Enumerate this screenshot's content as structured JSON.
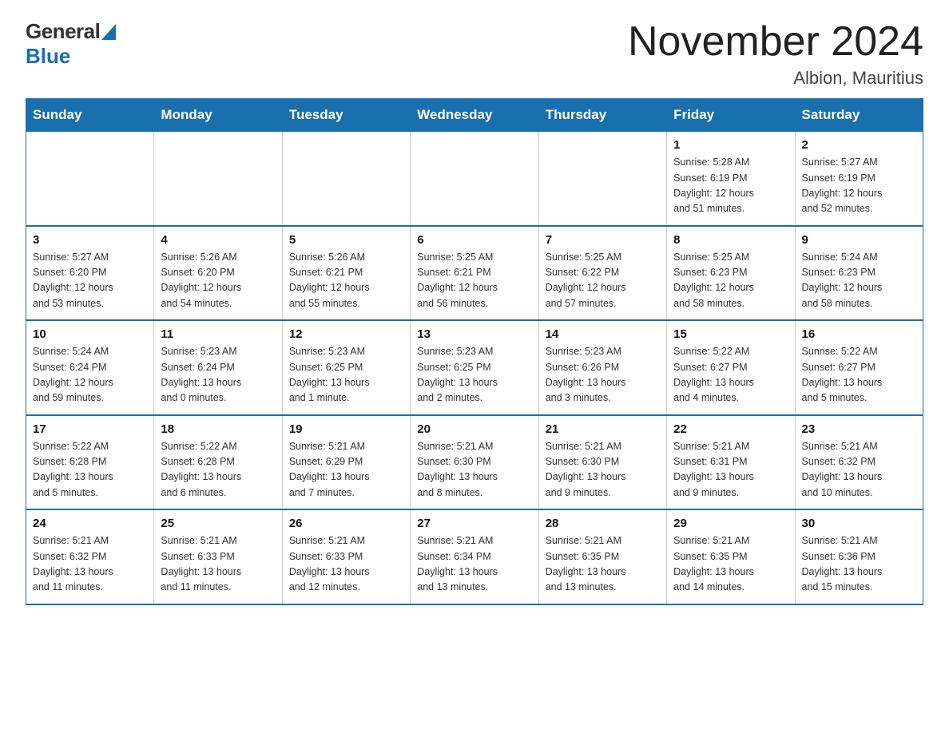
{
  "header": {
    "logo_general": "General",
    "logo_blue": "Blue",
    "title": "November 2024",
    "subtitle": "Albion, Mauritius"
  },
  "weekdays": [
    "Sunday",
    "Monday",
    "Tuesday",
    "Wednesday",
    "Thursday",
    "Friday",
    "Saturday"
  ],
  "weeks": [
    [
      {
        "day": "",
        "info": ""
      },
      {
        "day": "",
        "info": ""
      },
      {
        "day": "",
        "info": ""
      },
      {
        "day": "",
        "info": ""
      },
      {
        "day": "",
        "info": ""
      },
      {
        "day": "1",
        "info": "Sunrise: 5:28 AM\nSunset: 6:19 PM\nDaylight: 12 hours\nand 51 minutes."
      },
      {
        "day": "2",
        "info": "Sunrise: 5:27 AM\nSunset: 6:19 PM\nDaylight: 12 hours\nand 52 minutes."
      }
    ],
    [
      {
        "day": "3",
        "info": "Sunrise: 5:27 AM\nSunset: 6:20 PM\nDaylight: 12 hours\nand 53 minutes."
      },
      {
        "day": "4",
        "info": "Sunrise: 5:26 AM\nSunset: 6:20 PM\nDaylight: 12 hours\nand 54 minutes."
      },
      {
        "day": "5",
        "info": "Sunrise: 5:26 AM\nSunset: 6:21 PM\nDaylight: 12 hours\nand 55 minutes."
      },
      {
        "day": "6",
        "info": "Sunrise: 5:25 AM\nSunset: 6:21 PM\nDaylight: 12 hours\nand 56 minutes."
      },
      {
        "day": "7",
        "info": "Sunrise: 5:25 AM\nSunset: 6:22 PM\nDaylight: 12 hours\nand 57 minutes."
      },
      {
        "day": "8",
        "info": "Sunrise: 5:25 AM\nSunset: 6:23 PM\nDaylight: 12 hours\nand 58 minutes."
      },
      {
        "day": "9",
        "info": "Sunrise: 5:24 AM\nSunset: 6:23 PM\nDaylight: 12 hours\nand 58 minutes."
      }
    ],
    [
      {
        "day": "10",
        "info": "Sunrise: 5:24 AM\nSunset: 6:24 PM\nDaylight: 12 hours\nand 59 minutes."
      },
      {
        "day": "11",
        "info": "Sunrise: 5:23 AM\nSunset: 6:24 PM\nDaylight: 13 hours\nand 0 minutes."
      },
      {
        "day": "12",
        "info": "Sunrise: 5:23 AM\nSunset: 6:25 PM\nDaylight: 13 hours\nand 1 minute."
      },
      {
        "day": "13",
        "info": "Sunrise: 5:23 AM\nSunset: 6:25 PM\nDaylight: 13 hours\nand 2 minutes."
      },
      {
        "day": "14",
        "info": "Sunrise: 5:23 AM\nSunset: 6:26 PM\nDaylight: 13 hours\nand 3 minutes."
      },
      {
        "day": "15",
        "info": "Sunrise: 5:22 AM\nSunset: 6:27 PM\nDaylight: 13 hours\nand 4 minutes."
      },
      {
        "day": "16",
        "info": "Sunrise: 5:22 AM\nSunset: 6:27 PM\nDaylight: 13 hours\nand 5 minutes."
      }
    ],
    [
      {
        "day": "17",
        "info": "Sunrise: 5:22 AM\nSunset: 6:28 PM\nDaylight: 13 hours\nand 5 minutes."
      },
      {
        "day": "18",
        "info": "Sunrise: 5:22 AM\nSunset: 6:28 PM\nDaylight: 13 hours\nand 6 minutes."
      },
      {
        "day": "19",
        "info": "Sunrise: 5:21 AM\nSunset: 6:29 PM\nDaylight: 13 hours\nand 7 minutes."
      },
      {
        "day": "20",
        "info": "Sunrise: 5:21 AM\nSunset: 6:30 PM\nDaylight: 13 hours\nand 8 minutes."
      },
      {
        "day": "21",
        "info": "Sunrise: 5:21 AM\nSunset: 6:30 PM\nDaylight: 13 hours\nand 9 minutes."
      },
      {
        "day": "22",
        "info": "Sunrise: 5:21 AM\nSunset: 6:31 PM\nDaylight: 13 hours\nand 9 minutes."
      },
      {
        "day": "23",
        "info": "Sunrise: 5:21 AM\nSunset: 6:32 PM\nDaylight: 13 hours\nand 10 minutes."
      }
    ],
    [
      {
        "day": "24",
        "info": "Sunrise: 5:21 AM\nSunset: 6:32 PM\nDaylight: 13 hours\nand 11 minutes."
      },
      {
        "day": "25",
        "info": "Sunrise: 5:21 AM\nSunset: 6:33 PM\nDaylight: 13 hours\nand 11 minutes."
      },
      {
        "day": "26",
        "info": "Sunrise: 5:21 AM\nSunset: 6:33 PM\nDaylight: 13 hours\nand 12 minutes."
      },
      {
        "day": "27",
        "info": "Sunrise: 5:21 AM\nSunset: 6:34 PM\nDaylight: 13 hours\nand 13 minutes."
      },
      {
        "day": "28",
        "info": "Sunrise: 5:21 AM\nSunset: 6:35 PM\nDaylight: 13 hours\nand 13 minutes."
      },
      {
        "day": "29",
        "info": "Sunrise: 5:21 AM\nSunset: 6:35 PM\nDaylight: 13 hours\nand 14 minutes."
      },
      {
        "day": "30",
        "info": "Sunrise: 5:21 AM\nSunset: 6:36 PM\nDaylight: 13 hours\nand 15 minutes."
      }
    ]
  ]
}
